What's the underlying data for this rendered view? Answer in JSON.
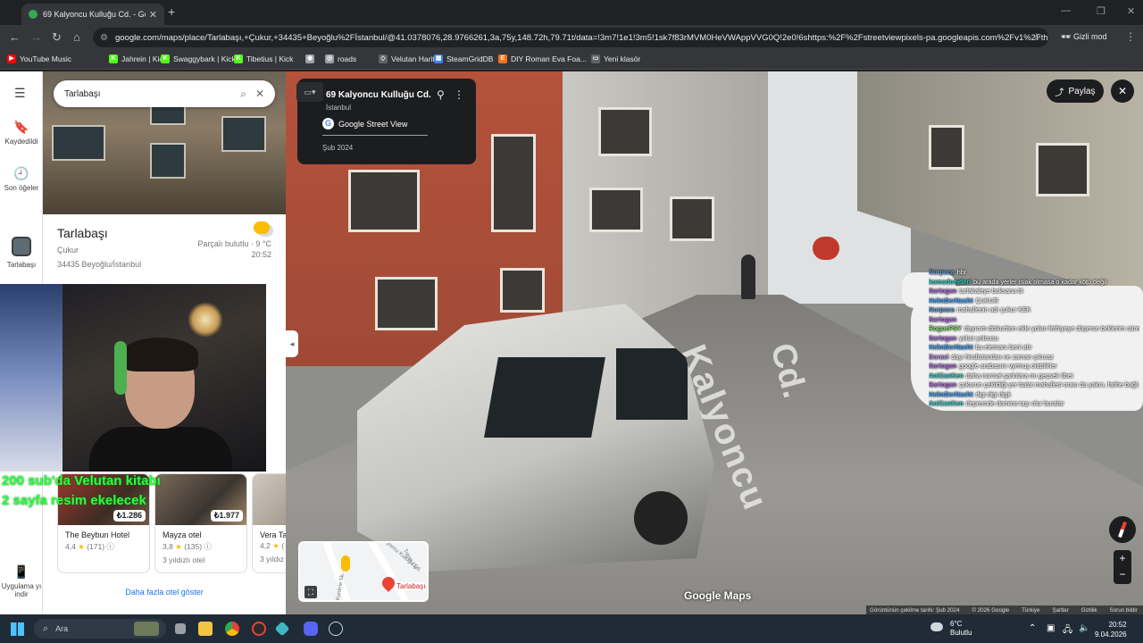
{
  "browser": {
    "tab_title": "69 Kalyoncu Kulluğu Cd. - Goo",
    "tab_close": "✕",
    "new_tab": "+",
    "win_min": "—",
    "win_max": "❐",
    "win_close": "✕",
    "url": "google.com/maps/place/Tarlabaşı,+Çukur,+34435+Beyoğlu%2Fİstanbul/@41.0378076,28.9766261,3a,75y,148.72h,79.71t/data=!3m7!1e1!3m5!1sk7f83rMVM0HeVWAppVVG0Q!2e0!6shttps:%2F%2Fstreetviewpixels-pa.googleapis.com%2Fv1%2Fthu...",
    "incognito_label": "Gizli mod",
    "bookmarks": [
      {
        "label": "YouTube Music",
        "color": "#ff0000",
        "glyph": "▶"
      },
      {
        "label": "Jahrein | Kick",
        "color": "#53fc18",
        "glyph": "K"
      },
      {
        "label": "Swaggybark | Kick",
        "color": "#53fc18",
        "glyph": "K"
      },
      {
        "label": "Tibetius | Kick",
        "color": "#53fc18",
        "glyph": "K"
      },
      {
        "label": "",
        "color": "#9aa0a6",
        "glyph": "◉"
      },
      {
        "label": "roads",
        "color": "#9aa0a6",
        "glyph": "◎"
      },
      {
        "label": "Velutan Harita",
        "color": "#5f6368",
        "glyph": "◇"
      },
      {
        "label": "SteamGridDB",
        "color": "#3b82f6",
        "glyph": "▦"
      },
      {
        "label": "DIY Roman Eva Foa...",
        "color": "#f97316",
        "glyph": "E"
      },
      {
        "label": "Yeni klasör",
        "color": "#5f6368",
        "glyph": "▭"
      }
    ]
  },
  "maps": {
    "rail": {
      "saved": "Kaydedildi",
      "recent": "Son öğeler",
      "place": "Tarlabaşı",
      "mobile": "Uygulama yı indir"
    },
    "search_value": "Tarlabaşı",
    "place_name": "Tarlabaşı",
    "place_district": "Çukur",
    "place_address": "34435 Beyoğlu/İstanbul",
    "weather_desc": "Parçalı bulutlu · 9 °C",
    "weather_time": "20:52",
    "hotels": [
      {
        "name": "The Beybun Hotel",
        "price": "₺1.286",
        "rating": "4,4",
        "reviews": "(171)",
        "class": ""
      },
      {
        "name": "Mayza otel",
        "price": "₺1.977",
        "rating": "3,8",
        "reviews": "(135)",
        "class": "3 yıldızlı otel"
      },
      {
        "name": "Vera Ta",
        "price": "",
        "rating": "4,2",
        "reviews": "(",
        "class": "3 yıldız"
      }
    ],
    "more_hotels": "Daha fazla otel göster"
  },
  "stream_overlay": {
    "line1": "200 sub'da Velutan kitabı",
    "line2": "2 sayfa resim ekelecek"
  },
  "streetview": {
    "card_title": "69 Kalyoncu Kulluğu Cd.",
    "card_city": "İstanbul",
    "card_source": "Google Street View",
    "card_date": "Şub 2024",
    "share": "Paylaş",
    "road_text_1": "Kalyoncu",
    "road_text_2": "Cd.",
    "google_maps_logo": "Google Maps",
    "minimap_label": "Tarlabaşı",
    "minimap_streets": [
      "Kurdele Sk.",
      "Turan Cd.",
      "Kalyoncu Kulluğu Cd."
    ],
    "bottom_bar": [
      "Görüntünün çekilme tarihi: Şub 2024",
      "© 2026 Google",
      "Türkiye",
      "Şartlar",
      "Gizlilik",
      "Sorun bildir"
    ]
  },
  "chat": [
    {
      "user": "Nurpaca",
      "color": "#5b9bd5",
      "msg": "hbr"
    },
    {
      "user": "komodoejderi",
      "color": "#2fd1c4",
      "msg": "bu arada yerler ıslak olmasa o kadar kötü değil"
    },
    {
      "user": "Sartogan",
      "color": "#b06ee0",
      "msg": "tarlakaleye baksana bi"
    },
    {
      "user": "HelmDerNacht",
      "color": "#3ea6ff",
      "msg": "ÇUKUR"
    },
    {
      "user": "Nurpaca",
      "color": "#5b9bd5",
      "msg": "mahallenin adı çukur KEK"
    },
    {
      "user": "Sartogan",
      "color": "#b06ee0",
      "msg": ""
    },
    {
      "user": "RoguePSY",
      "color": "#7ee06b",
      "msg": "dayıcım diskurtten ekle yolun fethiyeye düşerse beklerim sürersiz beraber"
    },
    {
      "user": "Sartogan",
      "color": "#b06ee0",
      "msg": "yolun yolcusu"
    },
    {
      "user": "HelmDerNacht",
      "color": "#3ea6ff",
      "msg": "bu elemanı beni alır"
    },
    {
      "user": "Boravi",
      "color": "#c08ae0",
      "msg": "dayı hindistandan ne zaman çıkıcaz"
    },
    {
      "user": "Sartogan",
      "color": "#b06ee0",
      "msg": "google arabasını vyrmuş olabilirler"
    },
    {
      "user": "AniCanKen",
      "color": "#2fd1c4",
      "msg": "daha normal şarkılara mı geçsek tibet"
    },
    {
      "user": "Sartogan",
      "color": "#b06ee0",
      "msg": "çukurun çekildiği yer balat mahallesi orası da yakın, fatihe bağlı"
    },
    {
      "user": "HelmDerNacht",
      "color": "#3ea6ff",
      "msg": "digi digi digii"
    },
    {
      "user": "AniCanKen",
      "color": "#2fd1c4",
      "msg": "depremde domino taşı olur buralar"
    }
  ],
  "taskbar": {
    "search_placeholder": "Ara",
    "weather_temp": "6°C",
    "weather_desc": "Bulutlu",
    "time": "20:52",
    "date": "9.04.2026"
  }
}
